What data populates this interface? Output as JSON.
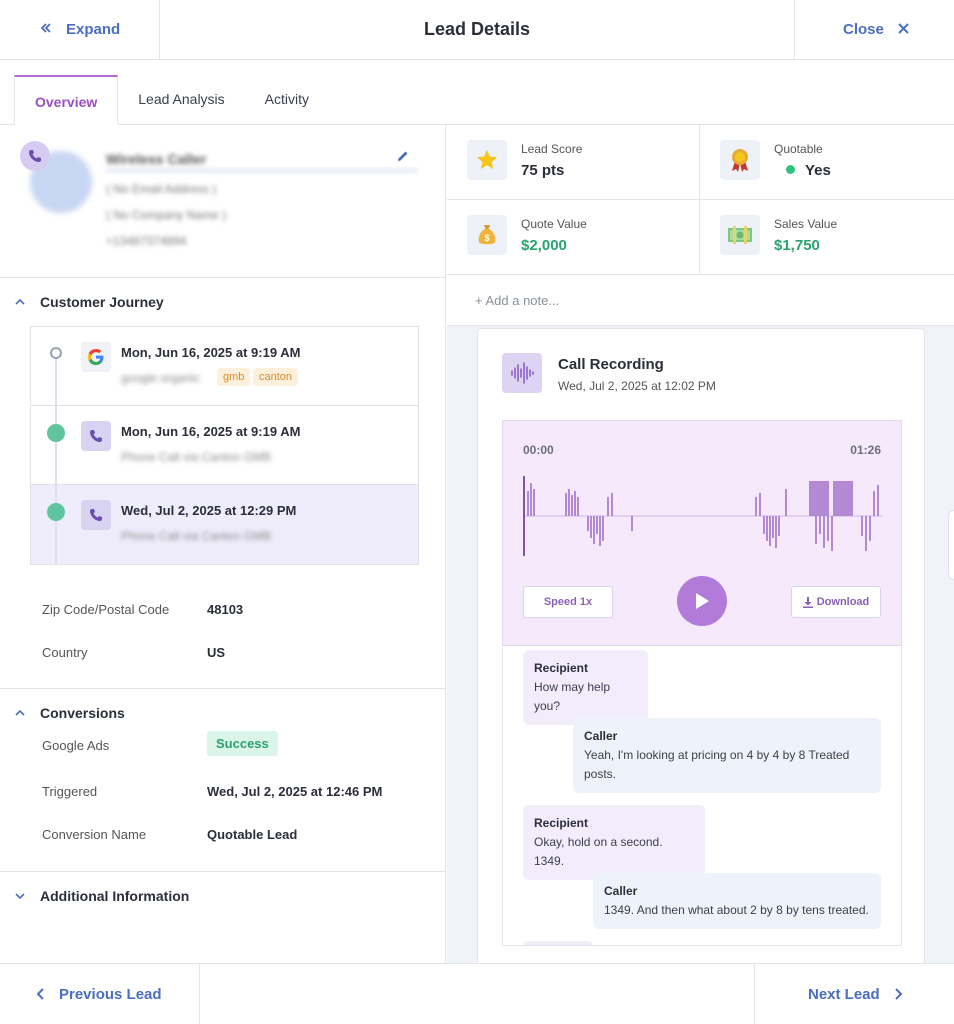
{
  "header": {
    "expand_label": "Expand",
    "title": "Lead Details",
    "close_label": "Close"
  },
  "tabs": [
    {
      "label": "Overview",
      "active": true
    },
    {
      "label": "Lead Analysis",
      "active": false
    },
    {
      "label": "Activity",
      "active": false
    }
  ],
  "contact": {
    "name": "Wireless Caller",
    "email": "( No Email Address )",
    "company": "( No Company Name )",
    "phone": "+13487374894"
  },
  "journey": {
    "title": "Customer Journey",
    "items": [
      {
        "date": "Mon, Jun 16, 2025 at 9:19 AM",
        "source": "google organic",
        "tags": [
          "gmb",
          "canton"
        ],
        "icon": "google-icon"
      },
      {
        "date": "Mon, Jun 16, 2025 at 9:19 AM",
        "source": "Phone Call via Canton GMB",
        "tags": [],
        "icon": "phone-icon"
      },
      {
        "date": "Wed, Jul 2, 2025 at 12:29 PM",
        "source": "Phone Call via Canton GMB",
        "tags": [],
        "icon": "phone-icon"
      }
    ]
  },
  "details": [
    {
      "label": "Zip Code/Postal Code",
      "value": "48103"
    },
    {
      "label": "Country",
      "value": "US"
    }
  ],
  "conversions": {
    "title": "Conversions",
    "google_ads_label": "Google Ads",
    "google_ads_status": "Success",
    "triggered_label": "Triggered",
    "triggered_value": "Wed, Jul 2, 2025 at 12:46 PM",
    "name_label": "Conversion Name",
    "name_value": "Quotable Lead"
  },
  "additional": {
    "title": "Additional Information"
  },
  "stats": {
    "lead_score_label": "Lead Score",
    "lead_score_value": "75 pts",
    "quotable_label": "Quotable",
    "quotable_value": "Yes",
    "quote_value_label": "Quote Value",
    "quote_value": "$2,000",
    "sales_value_label": "Sales Value",
    "sales_value": "$1,750"
  },
  "note_placeholder": "+ Add a note...",
  "recording": {
    "title": "Call Recording",
    "date": "Wed, Jul 2, 2025 at 12:02 PM",
    "time_start": "00:00",
    "time_end": "01:26",
    "speed_label": "Speed 1x",
    "download_label": "Download"
  },
  "transcript": [
    {
      "speaker": "Recipient",
      "text": "How may help you?"
    },
    {
      "speaker": "Caller",
      "text": "Yeah, I'm looking at pricing on 4 by 4 by 8 Treated posts."
    },
    {
      "speaker": "Recipient",
      "text": "Okay, hold on a second. 1349."
    },
    {
      "speaker": "Caller",
      "text": "1349. And then what about 2 by 8 by tens treated."
    }
  ],
  "footer": {
    "prev_label": "Previous Lead",
    "next_label": "Next Lead"
  },
  "colors": {
    "accent": "#9b4fc2",
    "link": "#4a6fc0",
    "success": "#2aa270",
    "journey_dot": "#5fc5a0"
  }
}
